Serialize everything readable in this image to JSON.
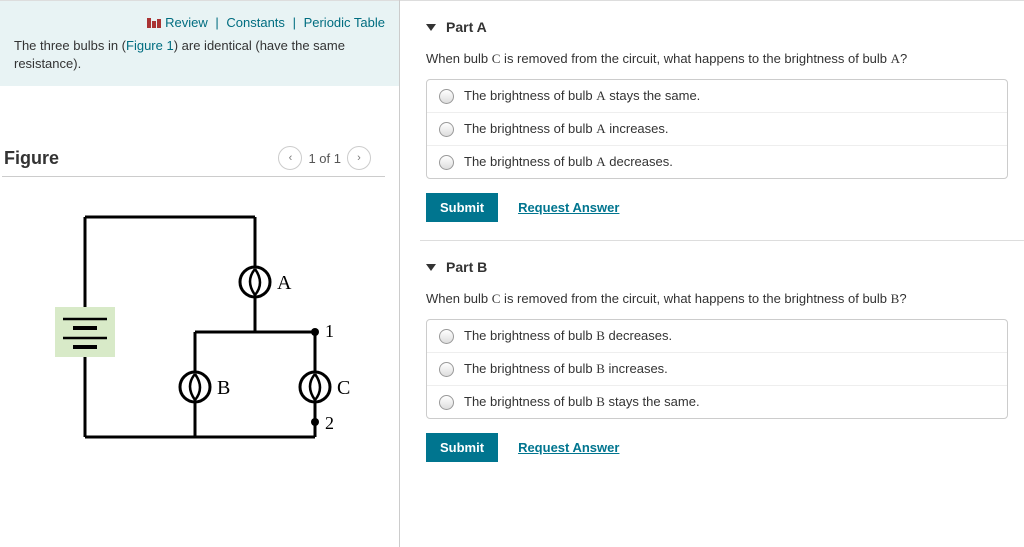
{
  "topLinks": {
    "review": "Review",
    "constants": "Constants",
    "periodic": "Periodic Table"
  },
  "intro": {
    "pre": "The three bulbs in (",
    "figLink": "Figure 1",
    "post": ") are identical (have the same resistance)."
  },
  "figure": {
    "title": "Figure",
    "counter": "1 of 1",
    "labels": {
      "A": "A",
      "B": "B",
      "C": "C",
      "one": "1",
      "two": "2"
    }
  },
  "partA": {
    "title": "Part A",
    "prompt_pre": "When bulb ",
    "prompt_c": "C",
    "prompt_mid": " is removed from the circuit, what happens to the brightness of bulb ",
    "prompt_a": "A",
    "prompt_post": "?",
    "opts": [
      {
        "pre": "The brightness of bulb ",
        "b": "A",
        "post": " stays the same."
      },
      {
        "pre": "The brightness of bulb ",
        "b": "A",
        "post": " increases."
      },
      {
        "pre": "The brightness of bulb ",
        "b": "A",
        "post": " decreases."
      }
    ],
    "submit": "Submit",
    "request": "Request Answer"
  },
  "partB": {
    "title": "Part B",
    "prompt_pre": "When bulb ",
    "prompt_c": "C",
    "prompt_mid": " is removed from the circuit, what happens to the brightness of bulb ",
    "prompt_b": "B",
    "prompt_post": "?",
    "opts": [
      {
        "pre": "The brightness of bulb ",
        "b": "B",
        "post": " decreases."
      },
      {
        "pre": "The brightness of bulb ",
        "b": "B",
        "post": " increases."
      },
      {
        "pre": "The brightness of bulb ",
        "b": "B",
        "post": " stays the same."
      }
    ],
    "submit": "Submit",
    "request": "Request Answer"
  }
}
